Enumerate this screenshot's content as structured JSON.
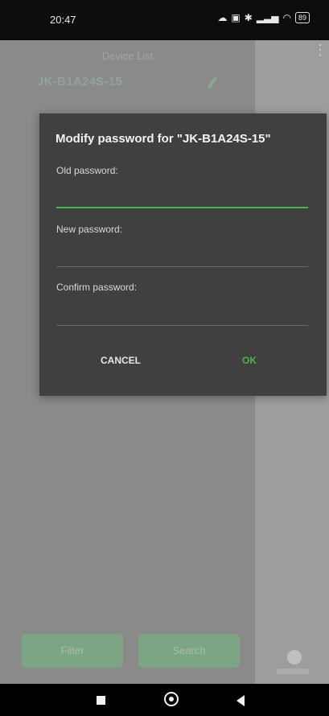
{
  "status": {
    "time": "20:47",
    "battery": "89"
  },
  "header": {
    "title": "Device List"
  },
  "device": {
    "name": "JK-B1A24S-15"
  },
  "dialog": {
    "title": "Modify password for \"JK-B1A24S-15\"",
    "old_label": "Old password:",
    "new_label": "New password:",
    "confirm_label": "Confirm password:",
    "cancel": "CANCEL",
    "ok": "OK"
  },
  "bottom": {
    "filter": "Filter",
    "search": "Search"
  },
  "colors": {
    "accent": "#49b84a",
    "dialog": "#404040",
    "overlay": "#8a8a8a"
  }
}
